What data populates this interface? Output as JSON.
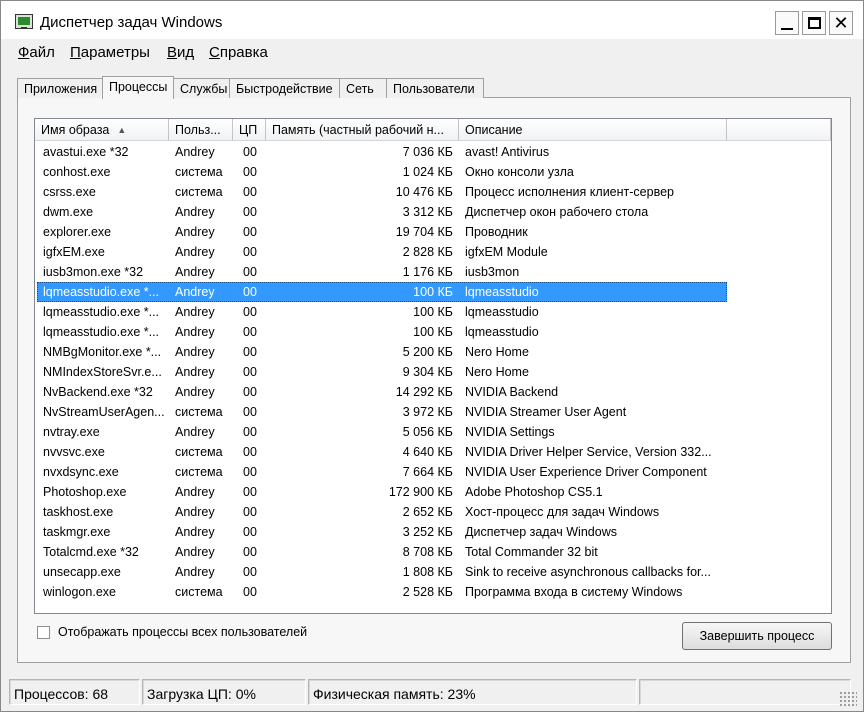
{
  "window": {
    "title": "Диспетчер задач Windows"
  },
  "menu": [
    {
      "u": "Ф",
      "rest": "айл"
    },
    {
      "u": "П",
      "rest": "араметры"
    },
    {
      "u": "В",
      "rest": "ид"
    },
    {
      "u": "С",
      "rest": "правка"
    }
  ],
  "tabs": [
    "Приложения",
    "Процессы",
    "Службы",
    "Быстродействие",
    "Сеть",
    "Пользователи"
  ],
  "active_tab": "Процессы",
  "table": {
    "columns": [
      "Имя образа",
      "Польз...",
      "ЦП",
      "Память (частный рабочий н...",
      "Описание"
    ],
    "sort_column": "Имя образа",
    "rows": [
      {
        "name": "avastui.exe *32",
        "user": "Andrey",
        "cpu": "00",
        "mem": "7 036 КБ",
        "desc": "avast! Antivirus"
      },
      {
        "name": "conhost.exe",
        "user": "система",
        "cpu": "00",
        "mem": "1 024 КБ",
        "desc": "Окно консоли узла"
      },
      {
        "name": "csrss.exe",
        "user": "система",
        "cpu": "00",
        "mem": "10 476 КБ",
        "desc": "Процесс исполнения клиент-сервер"
      },
      {
        "name": "dwm.exe",
        "user": "Andrey",
        "cpu": "00",
        "mem": "3 312 КБ",
        "desc": "Диспетчер окон рабочего стола"
      },
      {
        "name": "explorer.exe",
        "user": "Andrey",
        "cpu": "00",
        "mem": "19 704 КБ",
        "desc": "Проводник"
      },
      {
        "name": "igfxEM.exe",
        "user": "Andrey",
        "cpu": "00",
        "mem": "2 828 КБ",
        "desc": "igfxEM Module"
      },
      {
        "name": "iusb3mon.exe *32",
        "user": "Andrey",
        "cpu": "00",
        "mem": "1 176 КБ",
        "desc": "iusb3mon"
      },
      {
        "name": "lqmeasstudio.exe *...",
        "user": "Andrey",
        "cpu": "00",
        "mem": "100 КБ",
        "desc": "lqmeasstudio",
        "selected": true
      },
      {
        "name": "lqmeasstudio.exe *...",
        "user": "Andrey",
        "cpu": "00",
        "mem": "100 КБ",
        "desc": "lqmeasstudio"
      },
      {
        "name": "lqmeasstudio.exe *...",
        "user": "Andrey",
        "cpu": "00",
        "mem": "100 КБ",
        "desc": "lqmeasstudio"
      },
      {
        "name": "NMBgMonitor.exe *...",
        "user": "Andrey",
        "cpu": "00",
        "mem": "5 200 КБ",
        "desc": "Nero Home"
      },
      {
        "name": "NMIndexStoreSvr.e...",
        "user": "Andrey",
        "cpu": "00",
        "mem": "9 304 КБ",
        "desc": "Nero Home"
      },
      {
        "name": "NvBackend.exe *32",
        "user": "Andrey",
        "cpu": "00",
        "mem": "14 292 КБ",
        "desc": "NVIDIA Backend"
      },
      {
        "name": "NvStreamUserAgen...",
        "user": "система",
        "cpu": "00",
        "mem": "3 972 КБ",
        "desc": "NVIDIA Streamer User Agent"
      },
      {
        "name": "nvtray.exe",
        "user": "Andrey",
        "cpu": "00",
        "mem": "5 056 КБ",
        "desc": "NVIDIA Settings"
      },
      {
        "name": "nvvsvc.exe",
        "user": "система",
        "cpu": "00",
        "mem": "4 640 КБ",
        "desc": "NVIDIA Driver Helper Service, Version 332..."
      },
      {
        "name": "nvxdsync.exe",
        "user": "система",
        "cpu": "00",
        "mem": "7 664 КБ",
        "desc": "NVIDIA User Experience Driver Component"
      },
      {
        "name": "Photoshop.exe",
        "user": "Andrey",
        "cpu": "00",
        "mem": "172 900 КБ",
        "desc": "Adobe Photoshop CS5.1"
      },
      {
        "name": "taskhost.exe",
        "user": "Andrey",
        "cpu": "00",
        "mem": "2 652 КБ",
        "desc": "Хост-процесс для задач Windows"
      },
      {
        "name": "taskmgr.exe",
        "user": "Andrey",
        "cpu": "00",
        "mem": "3 252 КБ",
        "desc": "Диспетчер задач Windows"
      },
      {
        "name": "Totalcmd.exe *32",
        "user": "Andrey",
        "cpu": "00",
        "mem": "8 708 КБ",
        "desc": "Total Commander 32 bit"
      },
      {
        "name": "unsecapp.exe",
        "user": "Andrey",
        "cpu": "00",
        "mem": "1 808 КБ",
        "desc": "Sink to receive asynchronous callbacks for..."
      },
      {
        "name": "winlogon.exe",
        "user": "система",
        "cpu": "00",
        "mem": "2 528 КБ",
        "desc": "Программа входа в систему Windows"
      }
    ]
  },
  "show_all_users": {
    "label": "Отображать процессы всех пользователей",
    "checked": false
  },
  "end_process_button": "Завершить процесс",
  "status": {
    "processes": "Процессов: 68",
    "cpu_load": "Загрузка ЦП: 0%",
    "physical_memory": "Физическая память: 23%"
  },
  "colors": {
    "selection": "#3399ff",
    "background": "#f0f0f0"
  }
}
